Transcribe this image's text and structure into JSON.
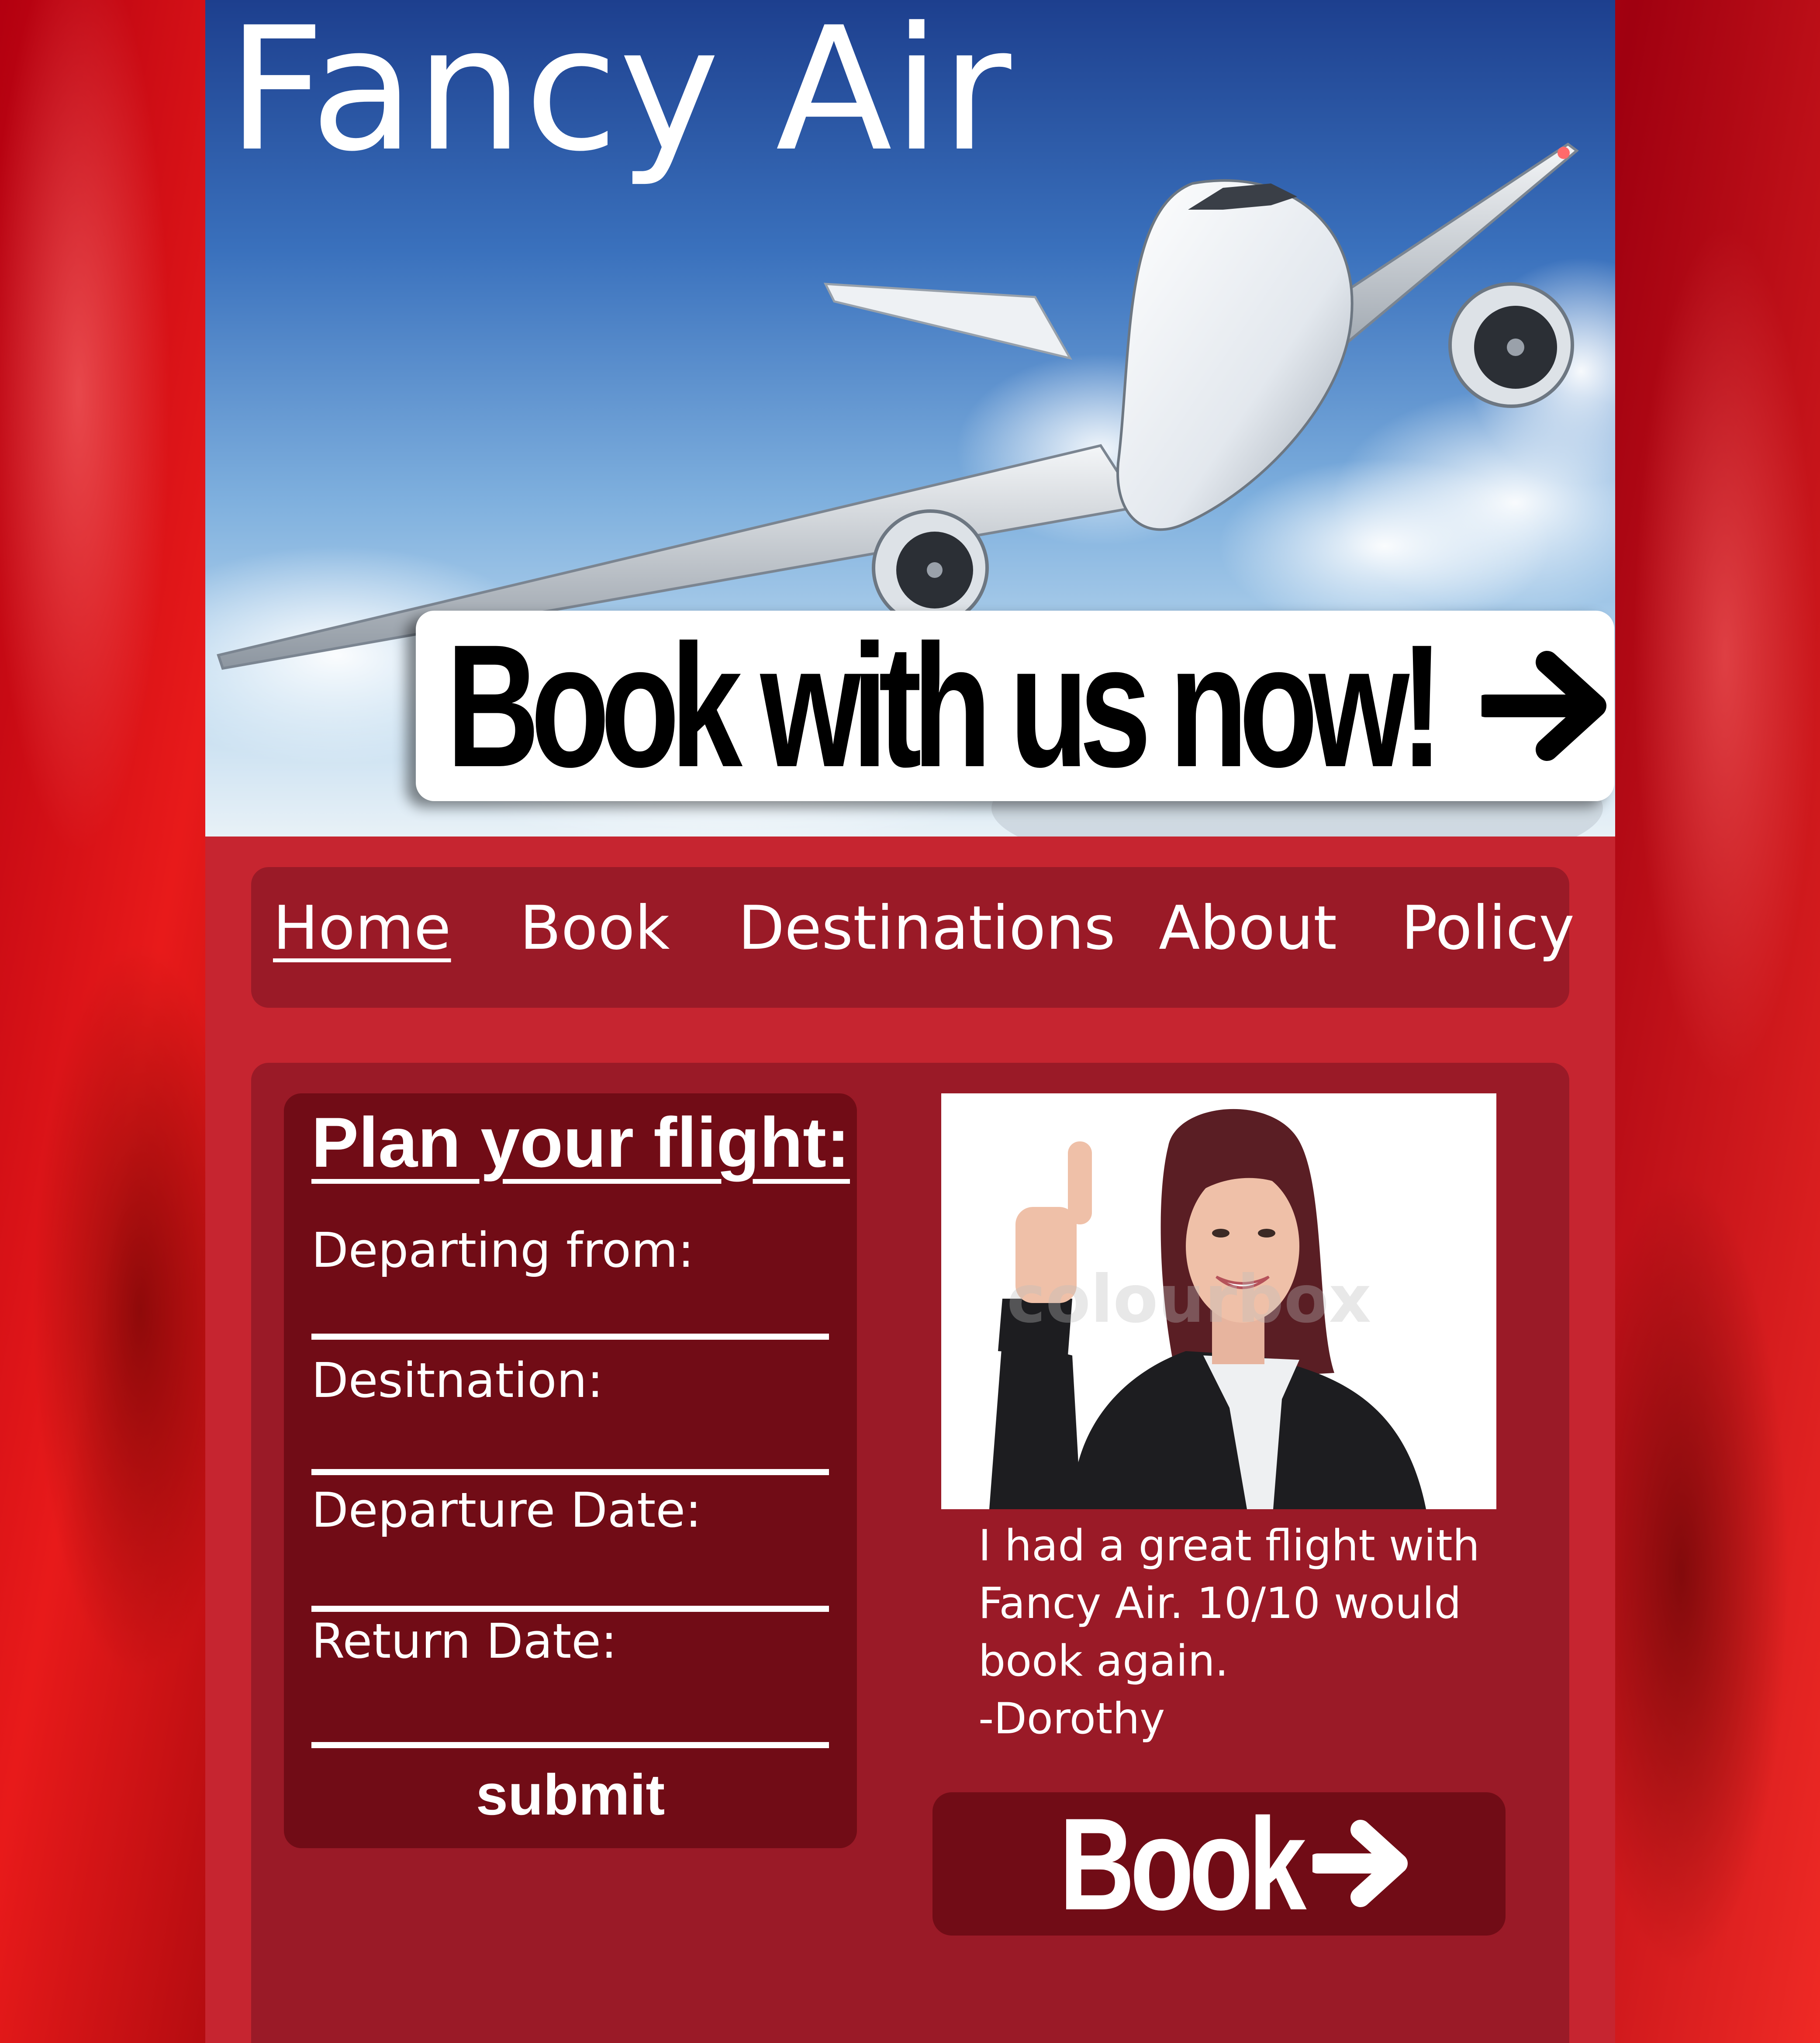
{
  "brand": {
    "name": "Fancy Air"
  },
  "hero": {
    "image": "airplane-photo",
    "cta_label": "Book with us now!",
    "cta_icon": "arrow-right-icon"
  },
  "nav": {
    "items": [
      {
        "label": "Home",
        "active": true
      },
      {
        "label": "Book"
      },
      {
        "label": "Destinations"
      },
      {
        "label": "About"
      },
      {
        "label": "Policy"
      }
    ]
  },
  "plan": {
    "title": "Plan your flight:",
    "fields": [
      {
        "label": "Departing from:",
        "value": ""
      },
      {
        "label": "Desitnation:",
        "value": ""
      },
      {
        "label": "Departure Date:",
        "value": ""
      },
      {
        "label": "Return Date:",
        "value": ""
      }
    ],
    "submit_label": "submit"
  },
  "testimonial": {
    "photo": "smiling-woman-thumbs-up-photo",
    "watermark": "colourbox",
    "quote_lines": [
      "I had a great flight with",
      "Fancy Air. 10/10 would",
      "book again."
    ],
    "author": "-Dorothy"
  },
  "book_button": {
    "label": "Book",
    "icon": "arrow-right-icon"
  },
  "colors": {
    "page_red": "#c62530",
    "panel_red": "#9a1a27",
    "dark_red": "#710c16",
    "background_satin": "#d3111a",
    "white": "#ffffff"
  }
}
